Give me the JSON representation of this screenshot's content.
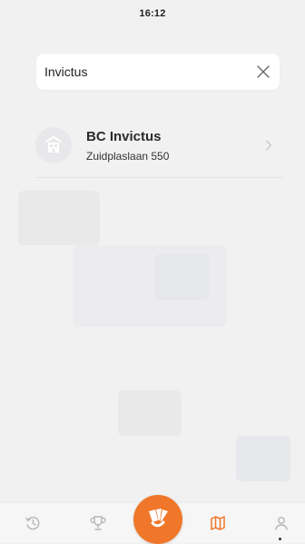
{
  "status_bar": {
    "time": "16:12"
  },
  "search": {
    "value": "Invictus",
    "placeholder": ""
  },
  "results": [
    {
      "title": "BC Invictus",
      "subtitle": "Zuidplaslaan 550",
      "icon": "building-icon"
    }
  ],
  "tab_bar": {
    "items": [
      {
        "icon": "history-icon"
      },
      {
        "icon": "trophy-icon"
      },
      {
        "icon": "shuttlecock-icon",
        "active": true
      },
      {
        "icon": "map-icon"
      },
      {
        "icon": "profile-icon"
      }
    ],
    "accent_color": "#f0772a"
  }
}
